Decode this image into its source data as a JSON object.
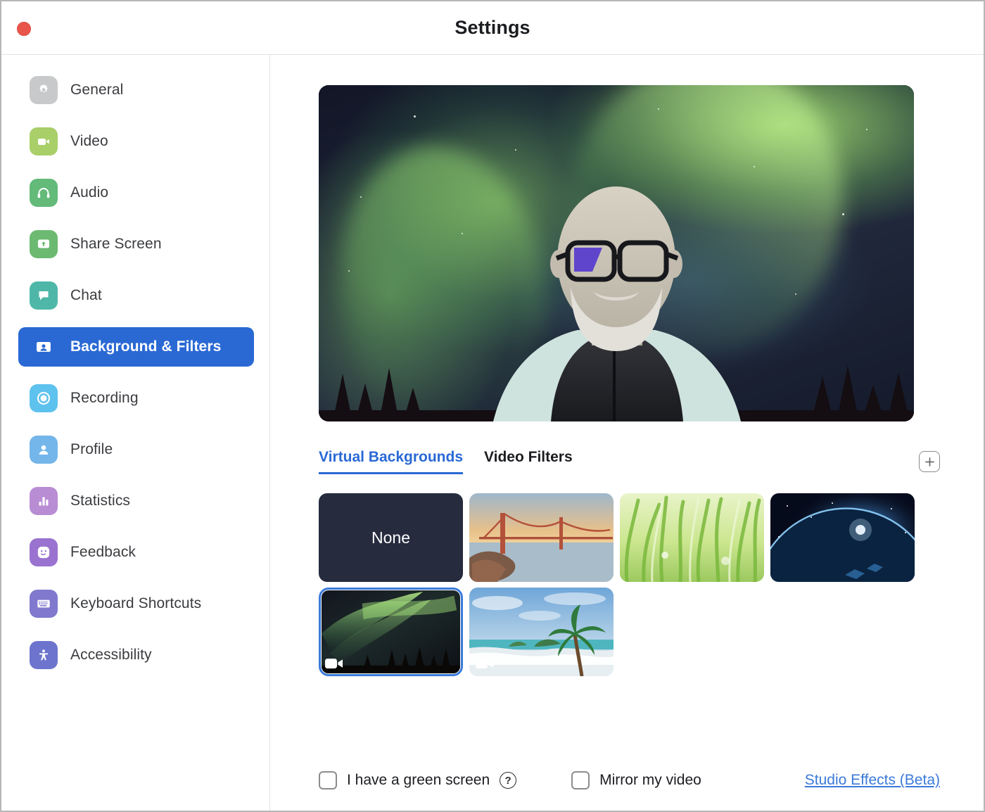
{
  "window": {
    "title": "Settings",
    "close_button_label": "Close",
    "accent_color": "#2a69d4",
    "link_color": "#3a7ad9",
    "close_color": "#e8564b"
  },
  "sidebar": {
    "items": [
      {
        "label": "General",
        "icon": "gear-icon",
        "color": "#c7c9cb",
        "active": false
      },
      {
        "label": "Video",
        "icon": "video-camera-icon",
        "color": "#a8cf68",
        "active": false
      },
      {
        "label": "Audio",
        "icon": "headphones-icon",
        "color": "#63ba79",
        "active": false
      },
      {
        "label": "Share Screen",
        "icon": "share-screen-icon",
        "color": "#6cba72",
        "active": false
      },
      {
        "label": "Chat",
        "icon": "chat-bubble-icon",
        "color": "#4fb7a8",
        "active": false
      },
      {
        "label": "Background & Filters",
        "icon": "person-card-icon",
        "color": "#2a69d4",
        "active": true
      },
      {
        "label": "Recording",
        "icon": "record-circle-icon",
        "color": "#5ec2ee",
        "active": false
      },
      {
        "label": "Profile",
        "icon": "person-icon",
        "color": "#74b6ea",
        "active": false
      },
      {
        "label": "Statistics",
        "icon": "bar-chart-icon",
        "color": "#b98dd4",
        "active": false
      },
      {
        "label": "Feedback",
        "icon": "smiley-face-icon",
        "color": "#9a72cf",
        "active": false
      },
      {
        "label": "Keyboard Shortcuts",
        "icon": "keyboard-icon",
        "color": "#8079ce",
        "active": false
      },
      {
        "label": "Accessibility",
        "icon": "accessibility-icon",
        "color": "#6d74cd",
        "active": false
      }
    ]
  },
  "main": {
    "preview": {
      "alt": "Self video preview with aurora borealis virtual background"
    },
    "tabs": [
      {
        "label": "Virtual Backgrounds",
        "active": true
      },
      {
        "label": "Video Filters",
        "active": false
      }
    ],
    "add_button_glyph": "+",
    "backgrounds": [
      {
        "name": "None",
        "type": "none",
        "selected": false,
        "has_video_badge": false
      },
      {
        "name": "Golden Gate Bridge",
        "type": "image",
        "selected": false,
        "has_video_badge": false
      },
      {
        "name": "Grass",
        "type": "image",
        "selected": false,
        "has_video_badge": false
      },
      {
        "name": "Earth from Space",
        "type": "image",
        "selected": false,
        "has_video_badge": false
      },
      {
        "name": "Aurora Borealis",
        "type": "video",
        "selected": true,
        "has_video_badge": true
      },
      {
        "name": "Tropical Beach",
        "type": "video",
        "selected": false,
        "has_video_badge": true
      }
    ]
  },
  "footer": {
    "green_screen_label": "I have a green screen",
    "green_screen_checked": false,
    "help_glyph": "?",
    "mirror_label": "Mirror my video",
    "mirror_checked": false,
    "studio_effects_label": "Studio Effects (Beta)"
  }
}
